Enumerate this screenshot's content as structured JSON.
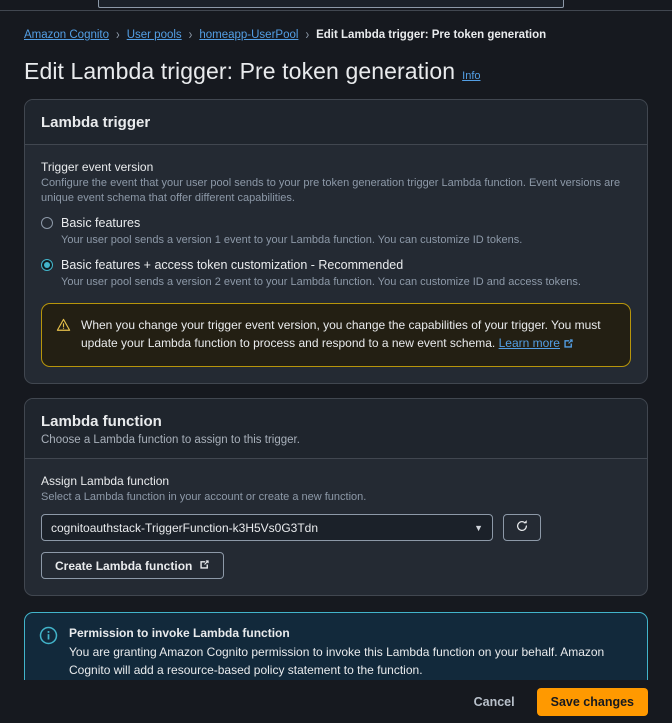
{
  "topbar": {
    "search_placeholder": ""
  },
  "breadcrumb": {
    "items": [
      {
        "label": "Amazon Cognito",
        "current": false
      },
      {
        "label": "User pools",
        "current": false
      },
      {
        "label": "homeapp-UserPool",
        "current": false
      },
      {
        "label": "Edit Lambda trigger: Pre token generation",
        "current": true
      }
    ],
    "separator": "›"
  },
  "header": {
    "title": "Edit Lambda trigger: Pre token generation",
    "info_label": "Info"
  },
  "lambda_trigger": {
    "container_title": "Lambda trigger",
    "field_label": "Trigger event version",
    "field_desc": "Configure the event that your user pool sends to your pre token generation trigger Lambda function. Event versions are unique event schema that offer different capabilities.",
    "options": [
      {
        "label": "Basic features",
        "desc": "Your user pool sends a version 1 event to your Lambda function. You can customize ID tokens.",
        "selected": false
      },
      {
        "label": "Basic features + access token customization - Recommended",
        "desc": "Your user pool sends a version 2 event to your Lambda function. You can customize ID and access tokens.",
        "selected": true
      }
    ],
    "warning": {
      "text": "When you change your trigger event version, you change the capabilities of your trigger. You must update your Lambda function to process and respond to a new event schema.",
      "link_label": "Learn more"
    }
  },
  "lambda_function": {
    "container_title": "Lambda function",
    "container_subtitle": "Choose a Lambda function to assign to this trigger.",
    "field_label": "Assign Lambda function",
    "field_desc": "Select a Lambda function in your account or create a new function.",
    "select_value": "cognitoauthstack-TriggerFunction-k3H5Vs0G3Tdn",
    "create_button_label": "Create Lambda function"
  },
  "permission_alert": {
    "title": "Permission to invoke Lambda function",
    "body": "You are granting Amazon Cognito permission to invoke this Lambda function on your behalf. Amazon Cognito will add a resource-based policy statement to the function."
  },
  "footer": {
    "cancel_label": "Cancel",
    "save_label": "Save changes"
  },
  "colors": {
    "page_bg": "#16191f",
    "container_bg": "#242a33",
    "accent_link": "#539fe5",
    "accent_selected": "#42b4ca",
    "warning_border": "#b7950b",
    "primary_button": "#ff9900"
  }
}
